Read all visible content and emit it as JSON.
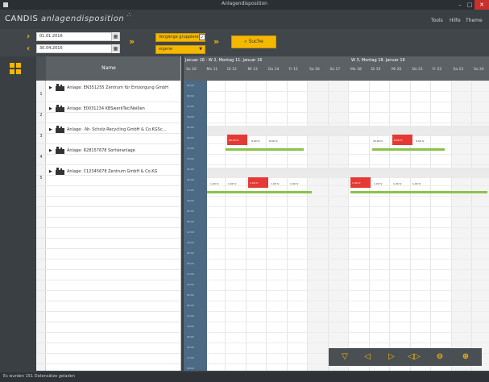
{
  "window": {
    "title": "Anlagendisposition",
    "minimize": "–",
    "maximize": "□",
    "close": "✕"
  },
  "logo": {
    "part1": "CANDIS",
    "part2": "anlagendisposition"
  },
  "menu": [
    "Tools",
    "Hilfe",
    "Theme"
  ],
  "filters": {
    "date_from": "01.01.2016",
    "date_to": "30.04.2016",
    "group_label": "Vorgänge gruppieren",
    "group_checked": "✓",
    "select_value": "eigene",
    "search_label": "Suche"
  },
  "name_panel": {
    "header": "Name",
    "rows": [
      {
        "num": "1",
        "label": "Anlage: EN351255 Zentrum für Entsorgung GmbH"
      },
      {
        "num": "2",
        "label": "Anlage: E0031234 KBSwerkTec/Neißen"
      },
      {
        "num": "3",
        "label": "Anlage: -Nr- Scholz-Recycling GmbH & Co.KGSc..."
      },
      {
        "num": "4",
        "label": "Anlage: R28157678 Sortieranlage"
      },
      {
        "num": "5",
        "label": "Anlage: C12345678 Zentrum GmbH & Co.KG"
      }
    ]
  },
  "gantt": {
    "weeks": [
      {
        "label": "Januar 16 · W 2, Montag 11. Januar 16"
      },
      {
        "label": "W 3, Montag 18. Januar 16"
      }
    ],
    "days": [
      "So 10",
      "Mo 11",
      "Di 12",
      "Mi 13",
      "Do 14",
      "Fr 15",
      "Sa 16",
      "So 17",
      "Mo 18",
      "Di 19",
      "Mi 20",
      "Do 21",
      "Fr 22",
      "Sa 23",
      "So 24"
    ],
    "time_ticks": [
      "00:00",
      "06:00",
      "12:00",
      "18:00"
    ],
    "bars": [
      {
        "row": 2,
        "type": "red",
        "label": "06,00 hr"
      },
      {
        "row": 2,
        "type": "text",
        "label": "8,00 hr"
      },
      {
        "row": 2,
        "type": "text",
        "label": "8,00 hr"
      },
      {
        "row": 2,
        "type": "text",
        "label": "20,00 hr"
      },
      {
        "row": 2,
        "type": "red",
        "label": "8,00 hr"
      },
      {
        "row": 2,
        "type": "text",
        "label": "8,00 hr"
      },
      {
        "row": 4,
        "type": "text",
        "label": "1,00 hr"
      },
      {
        "row": 4,
        "type": "text",
        "label": "1,00 hr"
      },
      {
        "row": 4,
        "type": "red",
        "label": "1,00 hr"
      },
      {
        "row": 4,
        "type": "text",
        "label": "1,00 hr"
      },
      {
        "row": 4,
        "type": "text",
        "label": "1,00 hr"
      },
      {
        "row": 4,
        "type": "red",
        "label": "1,00 hr"
      },
      {
        "row": 4,
        "type": "text",
        "label": "1,00 hr"
      },
      {
        "row": 4,
        "type": "text",
        "label": "1,00 hr"
      },
      {
        "row": 4,
        "type": "text",
        "label": "1,00 hr"
      }
    ]
  },
  "toolbar": {
    "collapse": "▽",
    "prev": "◁",
    "next": "▷",
    "fit": "◁▷",
    "zoom_out": "⊖",
    "zoom_in": "⊕"
  },
  "status": {
    "text": "Es wurden 151 Datensätze geladen"
  },
  "colors": {
    "accent": "#f5b800",
    "bar_red": "#e53935",
    "bar_green": "#8bc34a",
    "timebar": "#4d6a84"
  }
}
